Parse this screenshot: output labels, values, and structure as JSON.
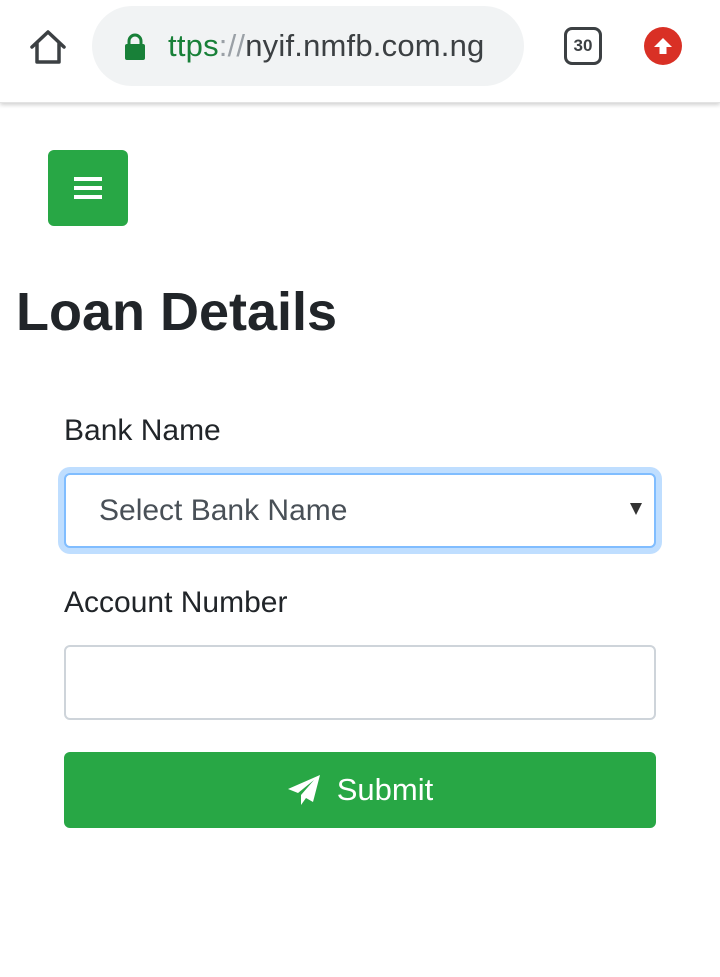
{
  "browser": {
    "url_scheme": "ttps",
    "url_separator": "://",
    "url_host": "nyif.nmfb.com.ng",
    "tab_count": "30",
    "icons": [
      "home-icon",
      "lock-icon",
      "tab-switcher-icon",
      "update-arrow-icon"
    ],
    "colors": {
      "scheme": "#188038",
      "update": "#d93025"
    }
  },
  "page": {
    "menu_icon": "hamburger-menu-icon",
    "title": "Loan Details",
    "accent": "#28a745"
  },
  "form": {
    "bank_label": "Bank Name",
    "bank_select_value": "Select Bank Name",
    "account_label": "Account Number",
    "account_value": "",
    "submit_label": "Submit",
    "submit_icon": "paper-plane-icon"
  }
}
